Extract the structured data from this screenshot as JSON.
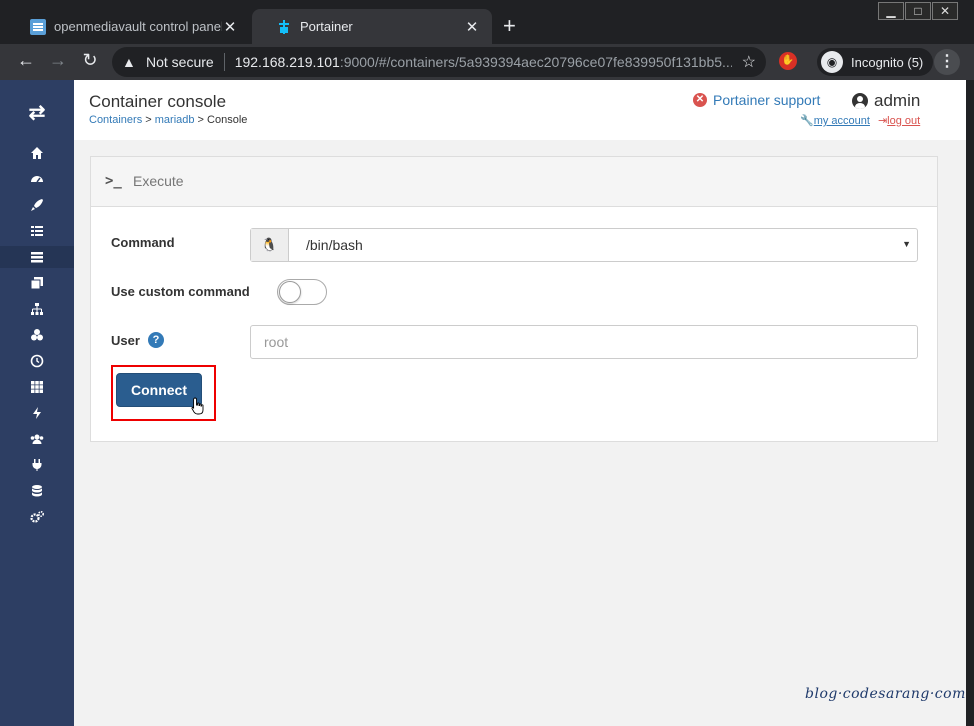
{
  "browser": {
    "tabs": [
      {
        "title": "openmediavault control panel - N",
        "active": false,
        "favicon": "omv-favicon"
      },
      {
        "title": "Portainer",
        "active": true,
        "favicon": "portainer-favicon"
      }
    ],
    "close_glyph": "✕",
    "new_tab_glyph": "+",
    "window_controls": [
      "▁",
      "□",
      "✕"
    ],
    "security_label": "Not secure",
    "url_host": "192.168.219.101",
    "url_rest": ":9000/#/containers/5a939394aec20796ce07fe839950f131bb5...",
    "profile_label": "Incognito (5)"
  },
  "sidebar": {
    "items": [
      {
        "icon": "home-icon",
        "active": false
      },
      {
        "icon": "dashboard-icon",
        "active": false
      },
      {
        "icon": "app-templates-icon",
        "active": false
      },
      {
        "icon": "stacks-icon",
        "active": false
      },
      {
        "icon": "containers-icon",
        "active": true
      },
      {
        "icon": "images-icon",
        "active": false
      },
      {
        "icon": "networks-icon",
        "active": false
      },
      {
        "icon": "volumes-icon",
        "active": false
      },
      {
        "icon": "events-icon",
        "active": false
      },
      {
        "icon": "host-icon",
        "active": false
      },
      {
        "icon": "extensions-icon",
        "active": false
      },
      {
        "icon": "users-icon",
        "active": false
      },
      {
        "icon": "endpoints-icon",
        "active": false
      },
      {
        "icon": "registries-icon",
        "active": false
      },
      {
        "icon": "settings-icon",
        "active": false
      }
    ]
  },
  "header": {
    "title": "Container console",
    "breadcrumb": {
      "containers": "Containers",
      "sep1": " > ",
      "container": "mariadb",
      "sep2": " > ",
      "current": "Console"
    },
    "support_label": "Portainer support",
    "username": "admin",
    "my_account": "my account",
    "log_out": "log out"
  },
  "panel": {
    "title": "Execute",
    "command_label": "Command",
    "command_value": "/bin/bash",
    "custom_command_label": "Use custom command",
    "custom_command_enabled": false,
    "user_label": "User",
    "user_placeholder": "root",
    "user_value": "",
    "connect_label": "Connect"
  },
  "watermark": "blog·codesarang·com",
  "colors": {
    "sidebar_bg": "#2d3e63",
    "primary_button": "#2a5d8f",
    "link": "#337ab7",
    "highlight_box": "#ee0000"
  }
}
